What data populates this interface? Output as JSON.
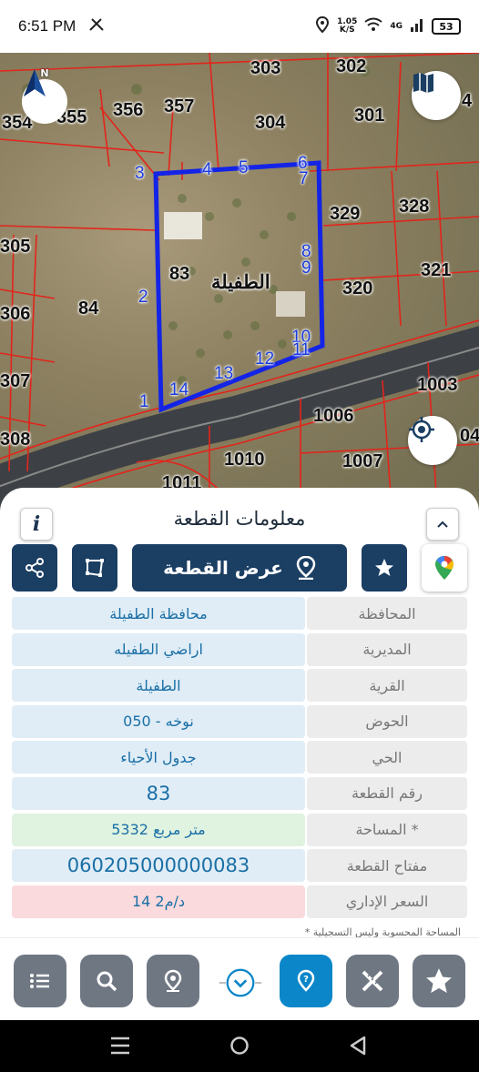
{
  "status": {
    "time": "6:51 PM",
    "speed_value": "1.05",
    "speed_unit": "K/S",
    "network": "4G",
    "battery": "53"
  },
  "map": {
    "parcel_labels": [
      {
        "text": "303"
      },
      {
        "text": "302"
      },
      {
        "text": "354"
      },
      {
        "text": "355"
      },
      {
        "text": "356"
      },
      {
        "text": "357"
      },
      {
        "text": "304"
      },
      {
        "text": "301"
      },
      {
        "text": "4"
      },
      {
        "text": "329"
      },
      {
        "text": "328"
      },
      {
        "text": "305"
      },
      {
        "text": "83"
      },
      {
        "text": "321"
      },
      {
        "text": "320"
      },
      {
        "text": "306"
      },
      {
        "text": "84"
      },
      {
        "text": "307"
      },
      {
        "text": "1003"
      },
      {
        "text": "1006"
      },
      {
        "text": "308"
      },
      {
        "text": "1010"
      },
      {
        "text": "1007"
      },
      {
        "text": "04"
      },
      {
        "text": "1011"
      }
    ],
    "village_label": "الطفيلة",
    "vertices": [
      "1",
      "2",
      "3",
      "4",
      "5",
      "6",
      "7",
      "8",
      "9",
      "10",
      "11",
      "12",
      "13",
      "14"
    ],
    "compass_letter": "N"
  },
  "panel": {
    "title": "معلومات القطعة",
    "info_glyph": "i",
    "view_button_label": "عرض القطعة",
    "rows": [
      {
        "label": "المحافظة",
        "value": "محافظة الطفيلة"
      },
      {
        "label": "المديرية",
        "value": "اراضي الطفيله"
      },
      {
        "label": "القرية",
        "value": "الطفيلة"
      },
      {
        "label": "الحوض",
        "value": "نوخه - 050"
      },
      {
        "label": "الحي",
        "value": "جدول الأحياء"
      },
      {
        "label": "رقم القطعة",
        "value": "83"
      },
      {
        "label": "المساحة *",
        "value": "5332 متر مربع"
      },
      {
        "label": "مفتاح القطعة",
        "value": "060205000000083"
      },
      {
        "label": "السعر الإداري",
        "value": "14 د/م2"
      }
    ],
    "note": "* المساحة المحسوبة وليس التسجيلية"
  },
  "colors": {
    "navy": "#1b3e63",
    "value_bg": "#e0edf6",
    "value_text": "#1a6fa6",
    "label_bg": "#ececec",
    "area_bg": "#dff3e0",
    "price_bg": "#fadadd",
    "toolbar_gray": "#6f7783",
    "toolbar_active": "#0a86c9",
    "parcel_line": "#e3241b",
    "parcel_highlight": "#1424e6"
  },
  "icons": {
    "toolbar": [
      "list-icon",
      "search-icon",
      "location-pin-icon",
      "chevron-down-icon",
      "help-pin-icon",
      "measure-icon",
      "favorite-icon"
    ]
  }
}
